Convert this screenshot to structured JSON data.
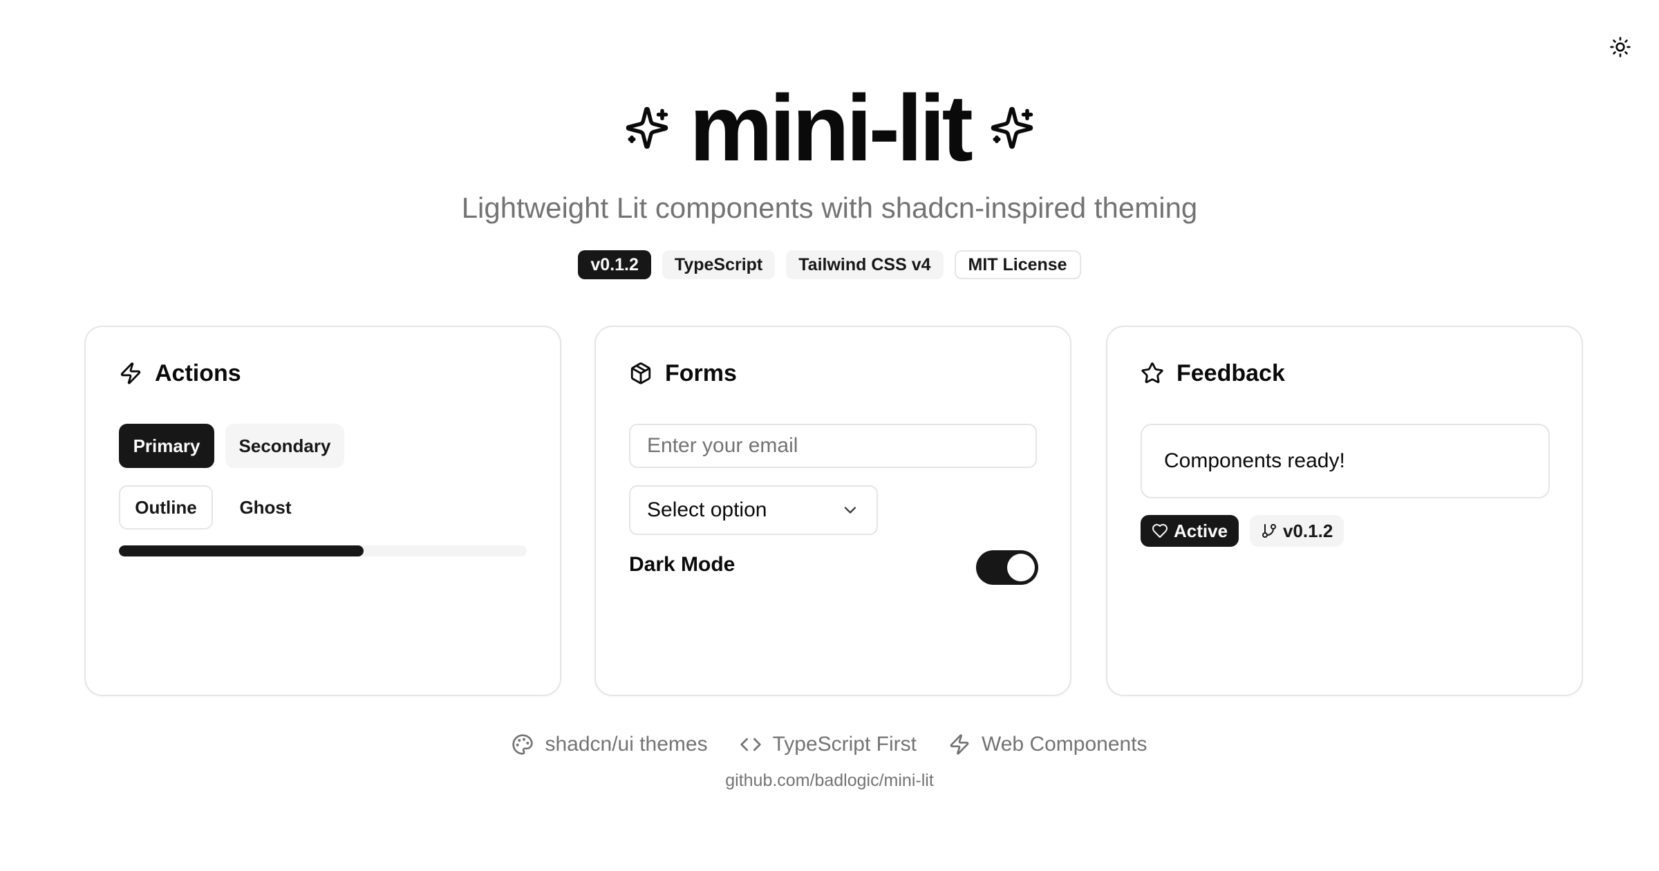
{
  "header": {
    "title": "mini-lit",
    "subtitle": "Lightweight Lit components with shadcn-inspired theming",
    "badges": [
      "v0.1.2",
      "TypeScript",
      "Tailwind CSS v4",
      "MIT License"
    ],
    "theme_toggle_icon": "sun-icon"
  },
  "cards": {
    "actions": {
      "title": "Actions",
      "icon": "zap-icon",
      "buttons": {
        "primary": "Primary",
        "secondary": "Secondary",
        "outline": "Outline",
        "ghost": "Ghost"
      },
      "progress_percent": 60
    },
    "forms": {
      "title": "Forms",
      "icon": "package-icon",
      "email_placeholder": "Enter your email",
      "select_value": "Select option",
      "dark_mode_label": "Dark Mode",
      "dark_mode_on": true
    },
    "feedback": {
      "title": "Feedback",
      "icon": "star-icon",
      "alert_text": "Components ready!",
      "badges": {
        "active": "Active",
        "version": "v0.1.2"
      }
    }
  },
  "features": [
    "shadcn/ui themes",
    "TypeScript First",
    "Web Components"
  ],
  "repo": "github.com/badlogic/mini-lit",
  "colors": {
    "primary": "#171717",
    "muted_text": "#737373",
    "border": "#e5e5e5",
    "muted_bg": "#f4f4f5",
    "background": "#ffffff"
  }
}
